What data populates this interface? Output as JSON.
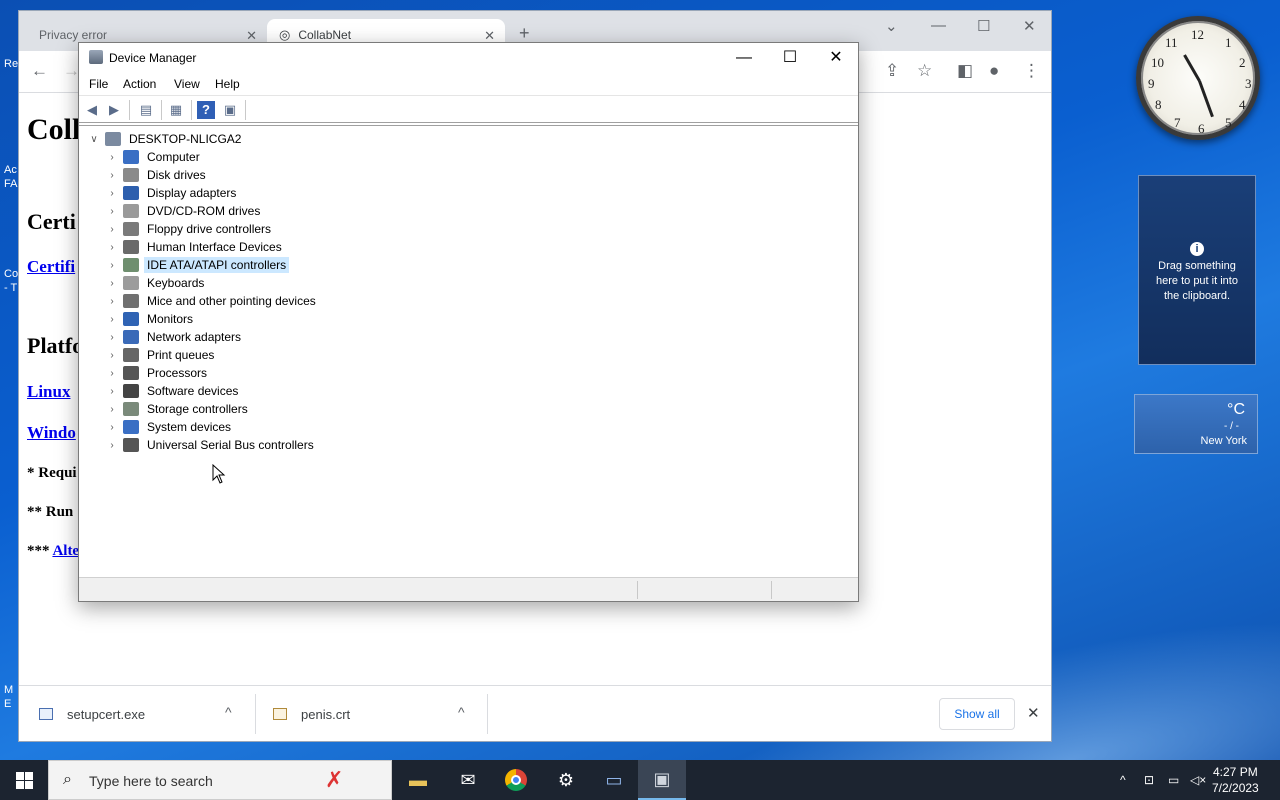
{
  "desktop": {
    "fragments": [
      "Re",
      "Ac",
      "FA",
      "Co",
      "- T",
      "M",
      "E"
    ]
  },
  "chrome": {
    "tabs": [
      {
        "label": "Privacy error",
        "active": false
      },
      {
        "label": "CollabNet",
        "active": true
      }
    ],
    "new_tab": "+",
    "page": {
      "heading": "Coll",
      "cert_heading": "Certi",
      "cert_link": "Certifi",
      "platform_heading": "Platfo",
      "linux_link": "Linux",
      "windows_link": "Windo",
      "note1": "* Requi",
      "note2": "** Run",
      "note3_prefix": "***",
      "note3_link": "Alte"
    },
    "downloads": [
      {
        "name": "setupcert.exe"
      },
      {
        "name": "penis.crt"
      }
    ],
    "show_all": "Show all"
  },
  "device_manager": {
    "title": "Device Manager",
    "menu": [
      "File",
      "Action",
      "View",
      "Help"
    ],
    "root": "DESKTOP-NLICGA2",
    "items": [
      {
        "label": "Computer",
        "color": "#3a6fc4"
      },
      {
        "label": "Disk drives",
        "color": "#8a8a8a"
      },
      {
        "label": "Display adapters",
        "color": "#2d5fae"
      },
      {
        "label": "DVD/CD-ROM drives",
        "color": "#9a9a9a"
      },
      {
        "label": "Floppy drive controllers",
        "color": "#7a7a7a"
      },
      {
        "label": "Human Interface Devices",
        "color": "#6a6a6a"
      },
      {
        "label": "IDE ATA/ATAPI controllers",
        "color": "#6f8f6f",
        "selected": true
      },
      {
        "label": "Keyboards",
        "color": "#9c9c9c"
      },
      {
        "label": "Mice and other pointing devices",
        "color": "#707070"
      },
      {
        "label": "Monitors",
        "color": "#2f63b4"
      },
      {
        "label": "Network adapters",
        "color": "#3a6ab8"
      },
      {
        "label": "Print queues",
        "color": "#666666"
      },
      {
        "label": "Processors",
        "color": "#555555"
      },
      {
        "label": "Software devices",
        "color": "#444444"
      },
      {
        "label": "Storage controllers",
        "color": "#7a8a7a"
      },
      {
        "label": "System devices",
        "color": "#3a6fc4"
      },
      {
        "label": "Universal Serial Bus controllers",
        "color": "#555555"
      }
    ]
  },
  "gadgets": {
    "clipboard_text": "Drag something here to put it into the clipboard.",
    "weather_unit": "°C",
    "weather_slash": "- / -",
    "weather_city": "New York"
  },
  "taskbar": {
    "search_placeholder": "Type here to search",
    "time": "4:27 PM",
    "date": "7/2/2023"
  }
}
